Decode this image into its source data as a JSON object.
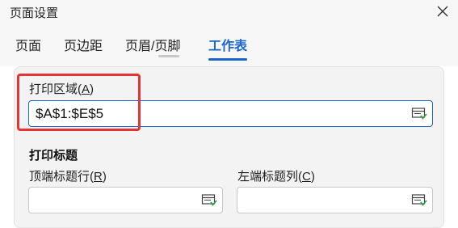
{
  "window": {
    "title": "页面设置"
  },
  "tabs": [
    {
      "label": "页面"
    },
    {
      "label": "页边距"
    },
    {
      "label": "页眉/页脚"
    },
    {
      "label": "工作表",
      "active": true
    }
  ],
  "print_area": {
    "label_prefix": "打印区域(",
    "hotkey": "A",
    "label_suffix": ")",
    "value": "$A$1:$E$5"
  },
  "print_titles": {
    "heading": "打印标题",
    "top_rows": {
      "label_prefix": "顶端标题行(",
      "hotkey": "R",
      "label_suffix": ")",
      "value": ""
    },
    "left_cols": {
      "label_prefix": "左端标题列(",
      "hotkey": "C",
      "label_suffix": ")",
      "value": ""
    }
  },
  "colors": {
    "accent": "#1a66c9",
    "highlight": "#e63333"
  },
  "icons": {
    "close": "close-icon",
    "range_select": "range-select-icon"
  }
}
